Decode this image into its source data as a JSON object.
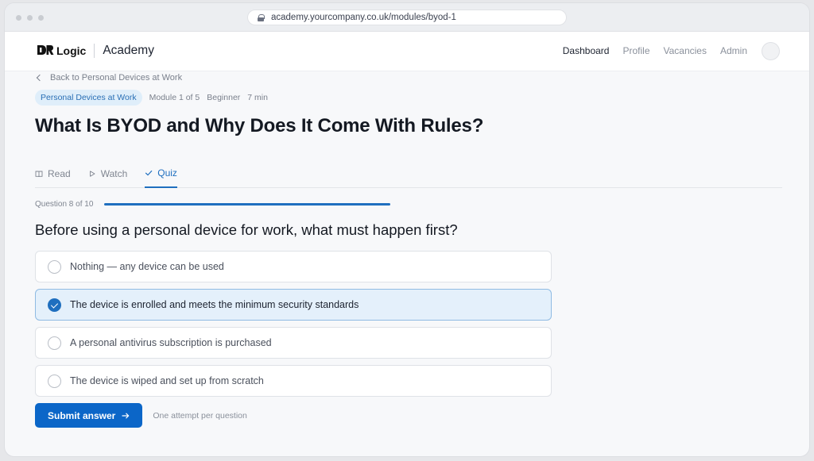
{
  "browser": {
    "url": "academy.yourcompany.co.uk/modules/byod-1"
  },
  "header": {
    "brand_mark": "DR",
    "brand_name": "Logic",
    "product": "Academy",
    "nav": [
      {
        "label": "Dashboard",
        "active": true
      },
      {
        "label": "Profile",
        "active": false
      },
      {
        "label": "Vacancies",
        "active": false
      },
      {
        "label": "Admin",
        "active": false
      }
    ]
  },
  "page": {
    "back_link": "Back to Personal Devices at Work",
    "course_pill": "Personal Devices at Work",
    "module": "Module 1 of 5",
    "level": "Beginner",
    "duration": "7 min",
    "title": "What Is BYOD and Why Does It Come With Rules?"
  },
  "tabs": [
    {
      "label": "Read",
      "icon": "book-icon",
      "active": false
    },
    {
      "label": "Watch",
      "icon": "play-icon",
      "active": false
    },
    {
      "label": "Quiz",
      "icon": "check-icon",
      "active": true
    }
  ],
  "quiz": {
    "progress_label": "Question 8 of 10",
    "progress_fraction": 0.8,
    "question": "Before using a personal device for work, what must happen first?",
    "options": [
      {
        "text": "Nothing — any device can be used",
        "selected": false
      },
      {
        "text": "The device is enrolled and meets the minimum security standards",
        "selected": true
      },
      {
        "text": "A personal antivirus subscription is purchased",
        "selected": false
      },
      {
        "text": "The device is wiped and set up from scratch",
        "selected": false
      }
    ],
    "submit_label": "Submit answer",
    "submit_icon": "arrow-right-icon",
    "hint": "One attempt per question"
  },
  "colors": {
    "accent": "#0b66c8",
    "selected_bg": "#e4f0fb",
    "pill_bg": "#dfeefa"
  }
}
